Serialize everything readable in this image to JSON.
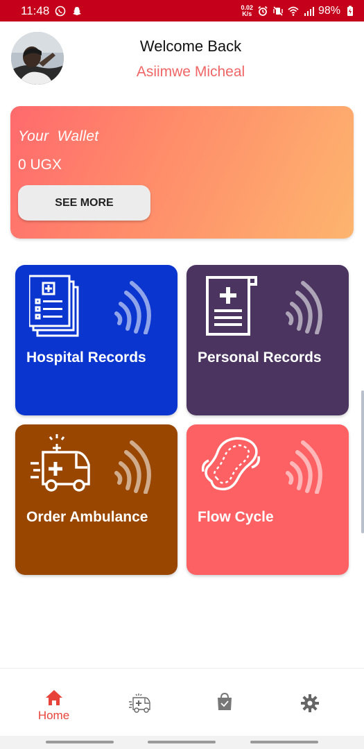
{
  "status_bar": {
    "time": "11:48",
    "speed_value": "0.02",
    "speed_unit": "K/s",
    "battery": "98%"
  },
  "header": {
    "welcome": "Welcome Back",
    "user_name": "Asiimwe Micheal"
  },
  "wallet": {
    "title": "Your  Wallet",
    "amount": "0 UGX",
    "see_more_label": "SEE MORE"
  },
  "tiles": [
    {
      "label": "Hospital Records",
      "icon": "hospital-records-icon",
      "color": "#0a35cf"
    },
    {
      "label": "Personal Records",
      "icon": "medical-document-icon",
      "color": "#4b3560"
    },
    {
      "label": "Order Ambulance",
      "icon": "ambulance-icon",
      "color": "#994700"
    },
    {
      "label": "Flow Cycle",
      "icon": "sanitary-pad-icon",
      "color": "#fd6163"
    }
  ],
  "bottom_nav": {
    "home_label": "Home",
    "items": [
      "home-icon",
      "ambulance-icon",
      "shopping-bag-icon",
      "settings-icon"
    ],
    "active_color": "#e8433a"
  }
}
